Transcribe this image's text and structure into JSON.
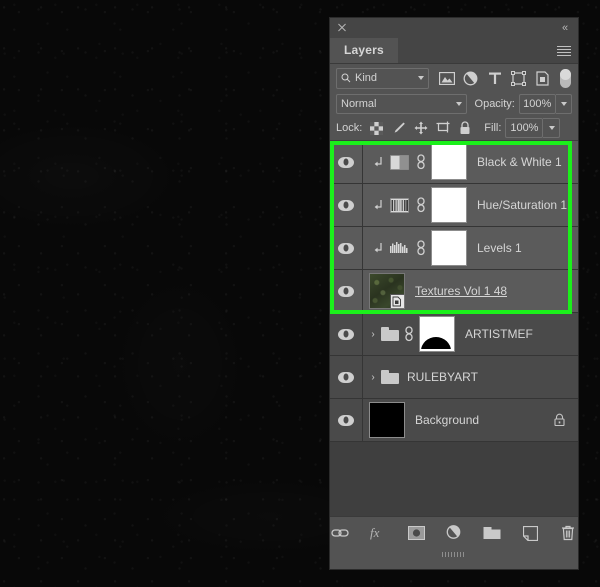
{
  "window": {
    "close_icon": "close-icon",
    "collapse_icon": "double-chevron-left-icon",
    "tab_label": "Layers",
    "menu_icon": "panel-menu-icon"
  },
  "filter_bar": {
    "kind_label": "Kind",
    "search_icon": "search-icon",
    "icons": [
      {
        "name": "filter-pixel-icon",
        "title": "Pixel Layers"
      },
      {
        "name": "filter-adjustment-icon",
        "title": "Adjustment Layers"
      },
      {
        "name": "filter-type-icon",
        "title": "Type Layers"
      },
      {
        "name": "filter-shape-icon",
        "title": "Shape Layers"
      },
      {
        "name": "filter-smart-object-icon",
        "title": "Smart Objects"
      }
    ],
    "toggle_name": "filter-enable-toggle"
  },
  "blend_bar": {
    "mode": "Normal",
    "opacity_label": "Opacity:",
    "opacity_value": "100%"
  },
  "lock_bar": {
    "lock_label": "Lock:",
    "icons": [
      {
        "name": "lock-transparent-pixels-icon"
      },
      {
        "name": "lock-image-pixels-icon"
      },
      {
        "name": "lock-position-icon"
      },
      {
        "name": "lock-artboard-nesting-icon"
      },
      {
        "name": "lock-all-icon"
      }
    ],
    "fill_label": "Fill:",
    "fill_value": "100%"
  },
  "selection": {
    "highlight_color": "#1bf01b",
    "selected_count": 4
  },
  "layers": [
    {
      "name": "Black & White 1",
      "type": "adjustment",
      "selected": true,
      "clipped": true,
      "linked": true,
      "visible": true,
      "adjustment_icon": "black-and-white-adjustment-icon",
      "mask": "white"
    },
    {
      "name": "Hue/Saturation 1",
      "type": "adjustment",
      "selected": true,
      "clipped": true,
      "linked": true,
      "visible": true,
      "adjustment_icon": "hue-saturation-adjustment-icon",
      "mask": "white"
    },
    {
      "name": "Levels 1",
      "type": "adjustment",
      "selected": true,
      "clipped": true,
      "linked": true,
      "visible": true,
      "adjustment_icon": "levels-adjustment-icon",
      "mask": "white"
    },
    {
      "name": "Textures Vol 1 48",
      "type": "smart-object",
      "selected": true,
      "clipped": false,
      "linked": false,
      "visible": true,
      "underlined": true,
      "thumbnail": "green-texture"
    },
    {
      "name": "ARTISTMEF",
      "type": "group",
      "selected": false,
      "linked": true,
      "visible": true,
      "mask": "black-dome"
    },
    {
      "name": "RULEBYART",
      "type": "group",
      "selected": false,
      "linked": false,
      "visible": true
    },
    {
      "name": "Background",
      "type": "pixel",
      "selected": false,
      "visible": true,
      "locked": true,
      "thumbnail": "black"
    }
  ],
  "footer": {
    "buttons": [
      {
        "name": "link-layers-button",
        "label": "Link layers"
      },
      {
        "name": "layer-style-fx-button",
        "label": "fx"
      },
      {
        "name": "add-layer-mask-button",
        "label": "Add layer mask"
      },
      {
        "name": "new-adjustment-layer-button",
        "label": "New adjustment layer"
      },
      {
        "name": "new-group-button",
        "label": "New group"
      },
      {
        "name": "new-layer-button",
        "label": "New layer"
      },
      {
        "name": "delete-layer-button",
        "label": "Delete layer"
      }
    ]
  }
}
